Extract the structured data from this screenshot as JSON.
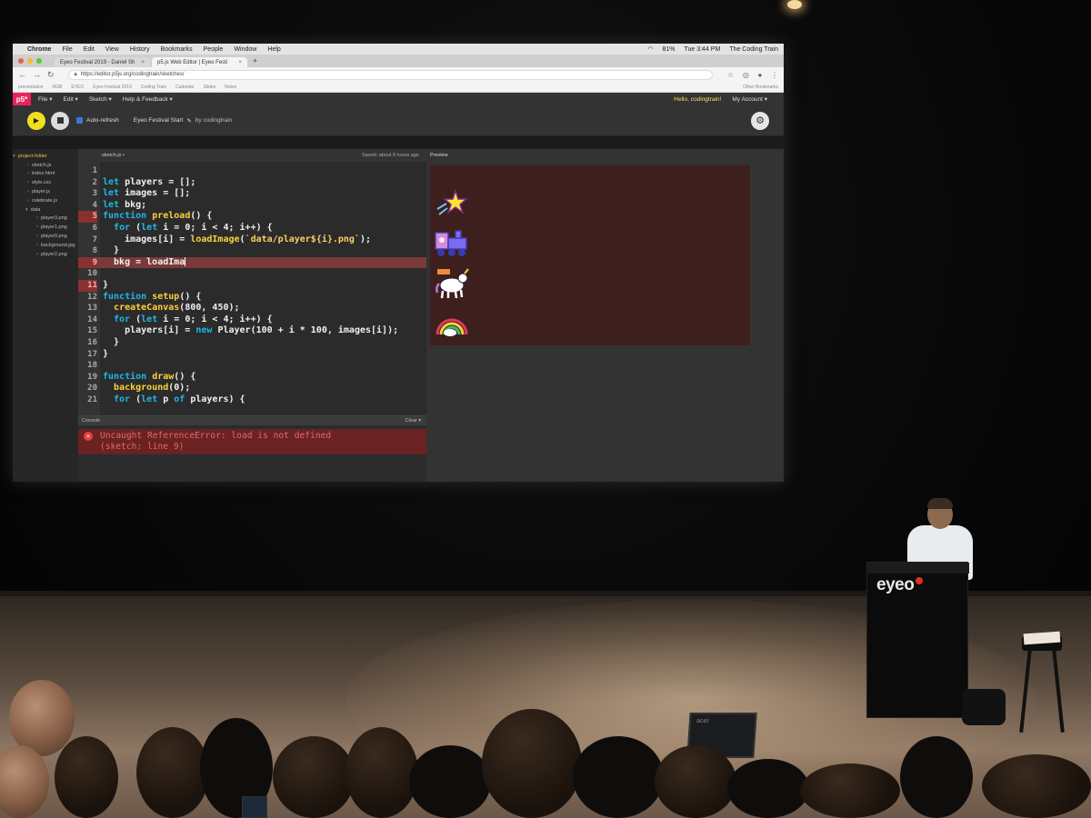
{
  "mac_menubar": {
    "app": "Chrome",
    "items": [
      "File",
      "Edit",
      "View",
      "History",
      "Bookmarks",
      "People",
      "Window",
      "Help"
    ],
    "battery": "81%",
    "clock": "Tue 3:44 PM",
    "user": "The Coding Train"
  },
  "browser": {
    "tabs": [
      {
        "title": "Eyeo Festival 2019 - Daniel Sh",
        "active": false
      },
      {
        "title": "p5.js Web Editor | Eyeo Festi",
        "active": true
      }
    ],
    "url": "https://editor.p5js.org/codingtrain/sketches/",
    "bookmarks": [
      "presentation",
      "RGB",
      "EYEO",
      "Eyeo Festival 2019",
      "Coding Train",
      "Calendar",
      "Slides",
      "Notes"
    ],
    "other_bookmarks": "Other Bookmarks"
  },
  "p5_nav": {
    "logo": "p5*",
    "menus": [
      "File ▾",
      "Edit ▾",
      "Sketch ▾",
      "Help & Feedback ▾"
    ],
    "greeting": "Hello, codingtrain!",
    "account": "My Account ▾"
  },
  "toolbar": {
    "auto_refresh": "Auto-refresh",
    "sketch_name": "Eyeo Festival Start",
    "by": "by codingtrain"
  },
  "sidebar": {
    "root": "project-folder",
    "files": [
      "sketch.js",
      "index.html",
      "style.css",
      "player.js",
      "celebrate.js"
    ],
    "data_folder": "data",
    "data_files": [
      "player3.png",
      "player1.png",
      "player0.png",
      "background.jpg",
      "player2.png"
    ]
  },
  "editor": {
    "tab": "sketch.js",
    "saved": "Saved: about 8 hours ago",
    "lines": [
      {
        "n": "1",
        "text": ""
      },
      {
        "n": "2",
        "text": "let players = [];"
      },
      {
        "n": "3",
        "text": "let images = [];"
      },
      {
        "n": "4",
        "text": "let bkg;"
      },
      {
        "n": "5",
        "text": "function preload() {"
      },
      {
        "n": "6",
        "text": "  for (let i = 0; i < 4; i++) {"
      },
      {
        "n": "7",
        "text": "    images[i] = loadImage(`data/player${i}.png`);"
      },
      {
        "n": "8",
        "text": "  }"
      },
      {
        "n": "9",
        "text": "  bkg = loadIma"
      },
      {
        "n": "10",
        "text": ""
      },
      {
        "n": "11",
        "text": "}"
      },
      {
        "n": "12",
        "text": "function setup() {"
      },
      {
        "n": "13",
        "text": "  createCanvas(800, 450);"
      },
      {
        "n": "14",
        "text": "  for (let i = 0; i < 4; i++) {"
      },
      {
        "n": "15",
        "text": "    players[i] = new Player(100 + i * 100, images[i]);"
      },
      {
        "n": "16",
        "text": "  }"
      },
      {
        "n": "17",
        "text": "}"
      },
      {
        "n": "18",
        "text": ""
      },
      {
        "n": "19",
        "text": "function draw() {"
      },
      {
        "n": "20",
        "text": "  background(0);"
      },
      {
        "n": "21",
        "text": "  for (let p of players) {"
      }
    ],
    "highlighted_line": "9",
    "marked_line_numbers": [
      "5",
      "9",
      "11"
    ]
  },
  "console": {
    "label": "Console",
    "clear": "Clear ▾",
    "error_line1": "Uncaught ReferenceError: load is not defined",
    "error_line2": "(sketch: line 9)"
  },
  "preview": {
    "label": "Preview",
    "sprites": [
      "star-sprite",
      "train-sprite",
      "unicorn-sprite",
      "rainbow-sprite"
    ]
  },
  "stage": {
    "podium_logo": "eyeo",
    "laptop_brand": "acer"
  },
  "colors": {
    "p5_pink": "#ed225d",
    "play_yellow": "#f0e020",
    "keyword_blue": "#1fb6e6",
    "function_yellow": "#ffd13a",
    "error_red": "#6a2222",
    "canvas_bg": "#3d1f1d"
  }
}
